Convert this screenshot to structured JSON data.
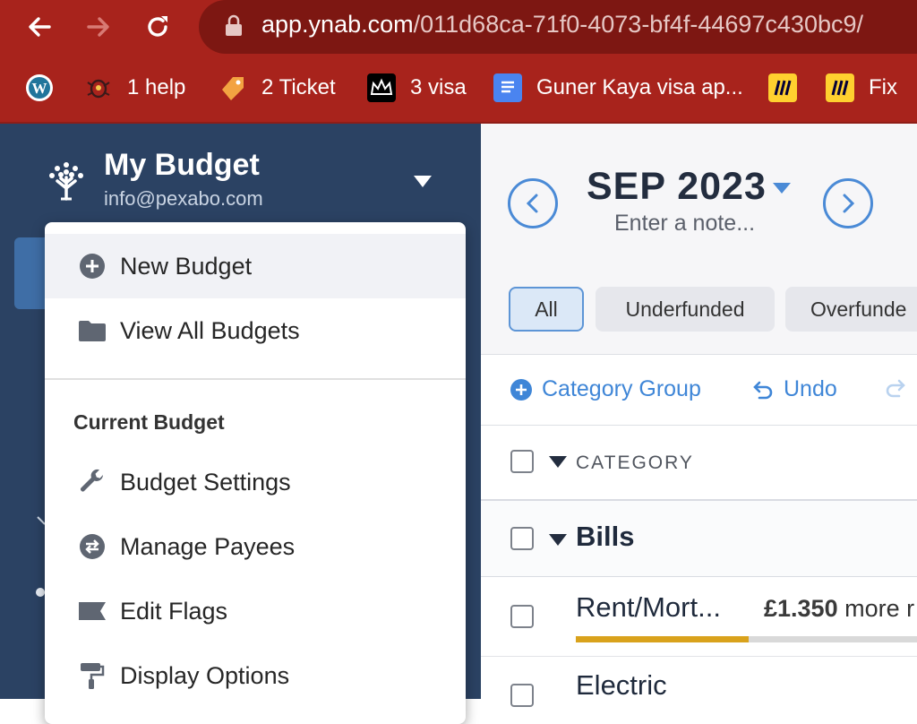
{
  "browser": {
    "url_domain": "app.ynab.com",
    "url_path": "/011d68ca-71f0-4073-bf4f-44697c430bc9/",
    "bookmarks": [
      {
        "label": "",
        "icon": "wordpress-icon"
      },
      {
        "label": "1 help",
        "icon": "bug-icon"
      },
      {
        "label": "2 Ticket",
        "icon": "tag-icon"
      },
      {
        "label": "3 visa",
        "icon": "crown-icon"
      },
      {
        "label": "Guner Kaya visa ap...",
        "icon": "docs-icon"
      },
      {
        "label": "",
        "icon": "miro-icon"
      },
      {
        "label": "Fix",
        "icon": "miro-icon"
      }
    ]
  },
  "sidebar": {
    "budget_name": "My Budget",
    "email": "info@pexabo.com"
  },
  "menu": {
    "items_top": [
      {
        "label": "New Budget",
        "icon": "plus-circle-icon"
      },
      {
        "label": "View All Budgets",
        "icon": "folder-icon"
      }
    ],
    "section_heading": "Current Budget",
    "items_current": [
      {
        "label": "Budget Settings",
        "icon": "wrench-icon"
      },
      {
        "label": "Manage Payees",
        "icon": "swap-arrows-icon"
      },
      {
        "label": "Edit Flags",
        "icon": "flag-icon"
      },
      {
        "label": "Display Options",
        "icon": "paint-roller-icon"
      }
    ]
  },
  "main": {
    "month": "SEP 2023",
    "note_placeholder": "Enter a note...",
    "filters": [
      "All",
      "Underfunded",
      "Overfunde"
    ],
    "active_filter": "All",
    "toolbar": {
      "add_group": "Category Group",
      "undo": "Undo"
    },
    "column_header": "CATEGORY",
    "groups": [
      {
        "name": "Bills",
        "categories": [
          {
            "name": "Rent/Mort...",
            "amount": "£1.350",
            "suffix": "more r",
            "progress": 0.46
          },
          {
            "name": "Electric",
            "amount": "",
            "suffix": "",
            "progress": null
          }
        ]
      }
    ]
  },
  "colors": {
    "chrome_red": "#a8231c",
    "sidebar_navy": "#2b4263",
    "accent_blue": "#3f86d7",
    "progress_gold": "#d9a21c"
  }
}
